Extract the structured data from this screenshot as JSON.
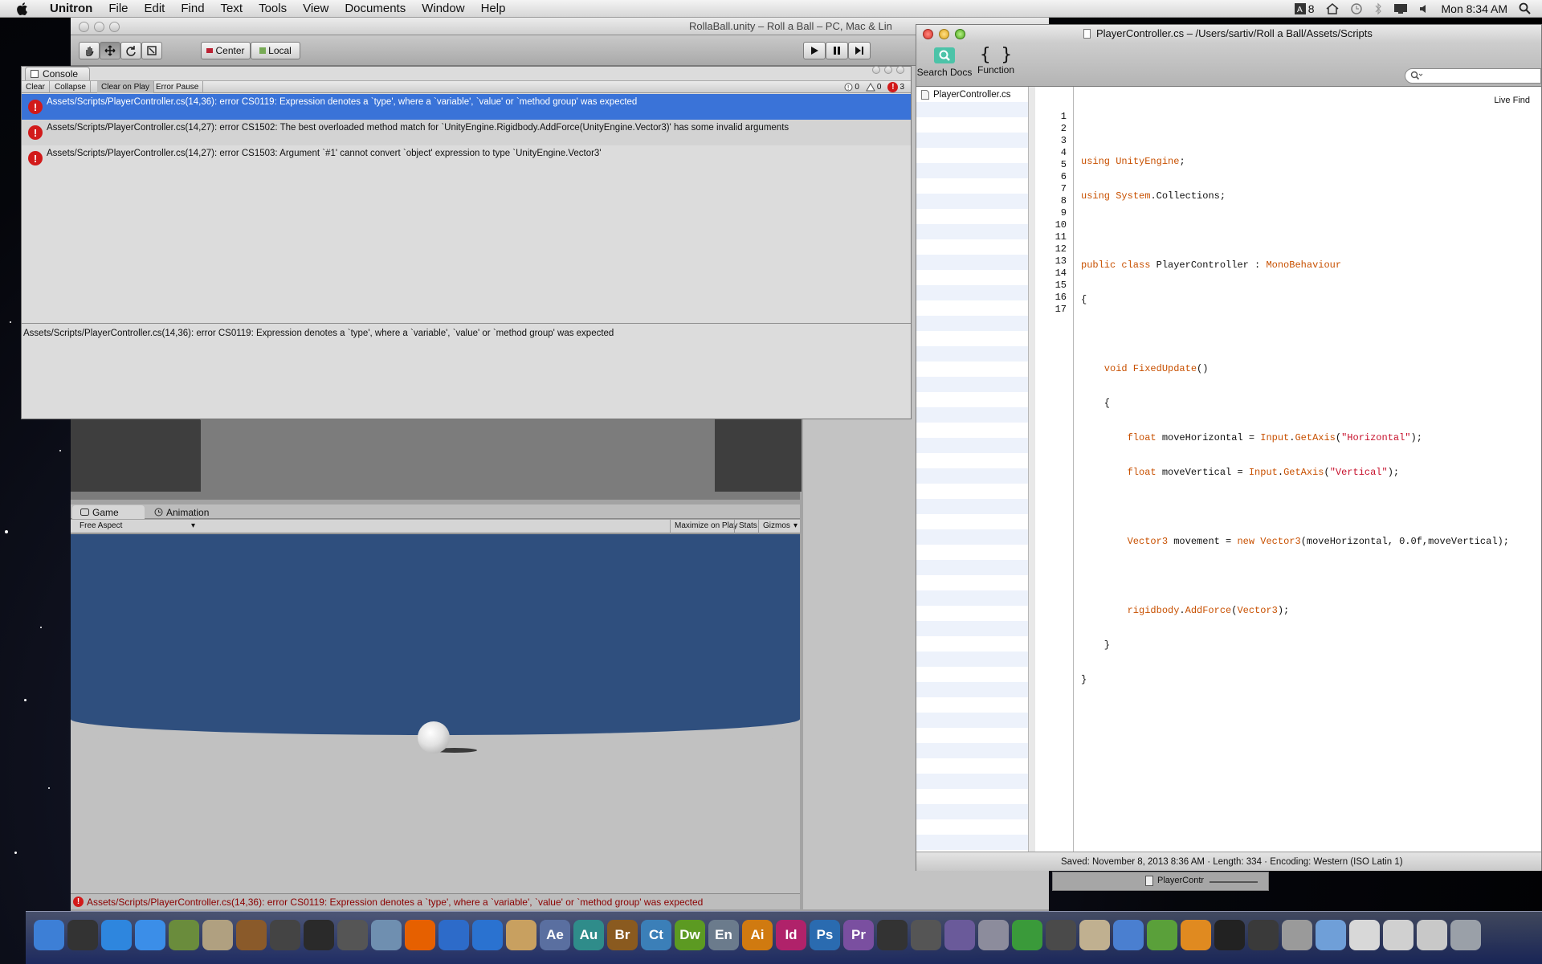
{
  "menubar": {
    "app": "Unitron",
    "items": [
      "File",
      "Edit",
      "Find",
      "Text",
      "Tools",
      "View",
      "Documents",
      "Window",
      "Help"
    ],
    "status_count": "8",
    "clock": "Mon 8:34 AM"
  },
  "unity": {
    "title": "RollaBall.unity – Roll a Ball – PC, Mac & Lin",
    "toolbar": {
      "center_label": "Center",
      "local_label": "Local"
    },
    "game_tab": "Game",
    "animation_tab": "Animation",
    "aspect": "Free Aspect",
    "maximize_label": "Maximize on Play",
    "stats_label": "Stats",
    "gizmos_label": "Gizmos",
    "status_error": "Assets/Scripts/PlayerController.cs(14,36): error CS0119: Expression denotes a `type', where a `variable', `value' or `method group' was expected",
    "bottom_panel_label": "PlayerContr"
  },
  "console": {
    "tab_label": "Console",
    "buttons": [
      "Clear",
      "Collapse",
      "Clear on Play",
      "Error Pause"
    ],
    "counts": {
      "info": "0",
      "warn": "0",
      "error": "3"
    },
    "rows": [
      "Assets/Scripts/PlayerController.cs(14,36): error CS0119: Expression denotes a `type', where a `variable', `value' or `method group' was expected",
      "Assets/Scripts/PlayerController.cs(14,27): error CS1502: The best overloaded method match for `UnityEngine.Rigidbody.AddForce(UnityEngine.Vector3)' has some invalid arguments",
      "Assets/Scripts/PlayerController.cs(14,27): error CS1503: Argument `#1' cannot convert `object' expression to type `UnityEngine.Vector3'"
    ],
    "detail": "Assets/Scripts/PlayerController.cs(14,36): error CS0119: Expression denotes a `type', where a `variable', `value' or `method group' was expected"
  },
  "xcode": {
    "title": "PlayerController.cs – /Users/sartiv/Roll a Ball/Assets/Scripts",
    "search_docs_label": "Search Docs",
    "function_label": "Function",
    "live_find_label": "Live Find",
    "file_name": "PlayerController.cs",
    "line_numbers": [
      "1",
      "2",
      "3",
      "4",
      "5",
      "6",
      "7",
      "8",
      "9",
      "10",
      "11",
      "12",
      "13",
      "14",
      "15",
      "16",
      "17"
    ],
    "status": "Saved: November 8, 2013 8:36 AM  ·  Length: 334  ·  Encoding: Western (ISO Latin 1)"
  },
  "code": {
    "l1a": "using",
    "l1b": " UnityEngine",
    "l1c": ";",
    "l2a": "using",
    "l2b": " System",
    "l2c": ".Collections;",
    "l4a": "public class",
    "l4b": " PlayerController : ",
    "l4c": "MonoBehaviour",
    "l5": "{",
    "l7a": "    void",
    "l7b": " FixedUpdate",
    "l7c": "()",
    "l8": "    {",
    "l9a": "        float",
    "l9b": " moveHorizontal = ",
    "l9c": "Input",
    "l9d": ".",
    "l9e": "GetAxis",
    "l9f": "(",
    "l9g": "\"Horizontal\"",
    "l9h": ");",
    "l10a": "        float",
    "l10b": " moveVertical = ",
    "l10c": "Input",
    "l10d": ".",
    "l10e": "GetAxis",
    "l10f": "(",
    "l10g": "\"Vertical\"",
    "l10h": ");",
    "l12a": "        Vector3",
    "l12b": " movement = ",
    "l12c": "new",
    "l12d": " ",
    "l12e": "Vector3",
    "l12f": "(moveHorizontal, ",
    "l12g": "0.0f",
    "l12h": ",moveVertical);",
    "l14a": "        rigidbody",
    "l14b": ".",
    "l14c": "AddForce",
    "l14d": "(",
    "l14e": "Vector3",
    "l14f": ");",
    "l15": "    }",
    "l16": "}"
  },
  "dock": {
    "icons": [
      {
        "name": "finder-icon",
        "label": "",
        "color": "#3d7fd6"
      },
      {
        "name": "dashboard-icon",
        "label": "",
        "color": "#333333"
      },
      {
        "name": "safari-icon",
        "label": "",
        "color": "#2e86de"
      },
      {
        "name": "itunes-icon",
        "label": "",
        "color": "#3b8ee8"
      },
      {
        "name": "iphoto-icon",
        "label": "",
        "color": "#6a8c3c"
      },
      {
        "name": "imovie-icon",
        "label": "",
        "color": "#b0a080"
      },
      {
        "name": "garageband-icon",
        "label": "",
        "color": "#8a5a2a"
      },
      {
        "name": "inkscape-icon",
        "label": "",
        "color": "#444444"
      },
      {
        "name": "quicksilver-icon",
        "label": "",
        "color": "#2a2a2a"
      },
      {
        "name": "activity-icon",
        "label": "",
        "color": "#555555"
      },
      {
        "name": "preview-icon",
        "label": "",
        "color": "#6f8fb0"
      },
      {
        "name": "firefox-icon",
        "label": "",
        "color": "#e66000"
      },
      {
        "name": "dvd-icon",
        "label": "",
        "color": "#2d6bc9"
      },
      {
        "name": "quicktime-icon",
        "label": "",
        "color": "#2a72d0"
      },
      {
        "name": "keynote-icon",
        "label": "",
        "color": "#c8a060"
      },
      {
        "name": "after-effects-icon",
        "label": "Ae",
        "color": "#5a6fa0"
      },
      {
        "name": "audition-icon",
        "label": "Au",
        "color": "#2f8c8a"
      },
      {
        "name": "bridge-icon",
        "label": "Br",
        "color": "#8a5a1f"
      },
      {
        "name": "contribute-icon",
        "label": "Ct",
        "color": "#3b7fb8"
      },
      {
        "name": "dreamweaver-icon",
        "label": "Dw",
        "color": "#5c9a22"
      },
      {
        "name": "encore-icon",
        "label": "En",
        "color": "#6b7b8c"
      },
      {
        "name": "illustrator-icon",
        "label": "Ai",
        "color": "#d07a10"
      },
      {
        "name": "indesign-icon",
        "label": "Id",
        "color": "#b0226a"
      },
      {
        "name": "photoshop-icon",
        "label": "Ps",
        "color": "#2a6bb0"
      },
      {
        "name": "premiere-icon",
        "label": "Pr",
        "color": "#7a4fa0"
      },
      {
        "name": "camera-icon",
        "label": "",
        "color": "#333333"
      },
      {
        "name": "clapper-icon",
        "label": "",
        "color": "#555555"
      },
      {
        "name": "color-icon",
        "label": "",
        "color": "#6a5a9a"
      },
      {
        "name": "disk-icon",
        "label": "",
        "color": "#8c8c9c"
      },
      {
        "name": "seahorse-icon",
        "label": "",
        "color": "#3a9a3a"
      },
      {
        "name": "movie-icon",
        "label": "",
        "color": "#4a4a4a"
      },
      {
        "name": "script-icon",
        "label": "",
        "color": "#c0b090"
      },
      {
        "name": "widget-icon",
        "label": "",
        "color": "#4a7fd0"
      },
      {
        "name": "green-icon",
        "label": "",
        "color": "#5aa03a"
      },
      {
        "name": "pages-icon",
        "label": "",
        "color": "#e08a20"
      },
      {
        "name": "unity-icon",
        "label": "",
        "color": "#222222"
      },
      {
        "name": "pen-icon",
        "label": "",
        "color": "#3a3a3a"
      },
      {
        "name": "photo-icon",
        "label": "",
        "color": "#9a9a9a"
      },
      {
        "name": "folder-icon",
        "label": "",
        "color": "#6f9fd8"
      },
      {
        "name": "doc-icon-1",
        "label": "",
        "color": "#d8d8d8"
      },
      {
        "name": "doc-icon-2",
        "label": "",
        "color": "#d0d0d0"
      },
      {
        "name": "doc-icon-3",
        "label": "",
        "color": "#c8c8c8"
      },
      {
        "name": "trash-icon",
        "label": "",
        "color": "#9aa0a8"
      }
    ]
  }
}
